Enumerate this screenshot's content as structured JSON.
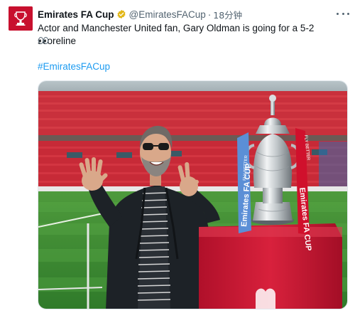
{
  "tweet": {
    "account_name": "Emirates FA Cup",
    "handle": "@EmiratesFACup",
    "separator": "·",
    "time": "18分钟",
    "text": "Actor and Manchester United fan, Gary Oldman is going for a 5-2 scoreline",
    "emoji": "👀",
    "hashtag": "#EmiratesFACup",
    "avatar_icon": "fa-cup-logo-icon",
    "verified_icon": "verified-badge-icon",
    "more_icon": "more-options-icon"
  },
  "media": {
    "ribbon_left_text": "Emirates FA CUP",
    "ribbon_right_text": "Emirates FA CUP",
    "ribbon_right_small": "FLY BETTER",
    "ribbon_left_small": "FLY BETTER"
  },
  "colors": {
    "brand_red": "#c8102e",
    "link_blue": "#1d9bf0",
    "verified_gold": "#e2b719",
    "muted_text": "#536471",
    "ribbon_blue": "#5b8fd6"
  }
}
